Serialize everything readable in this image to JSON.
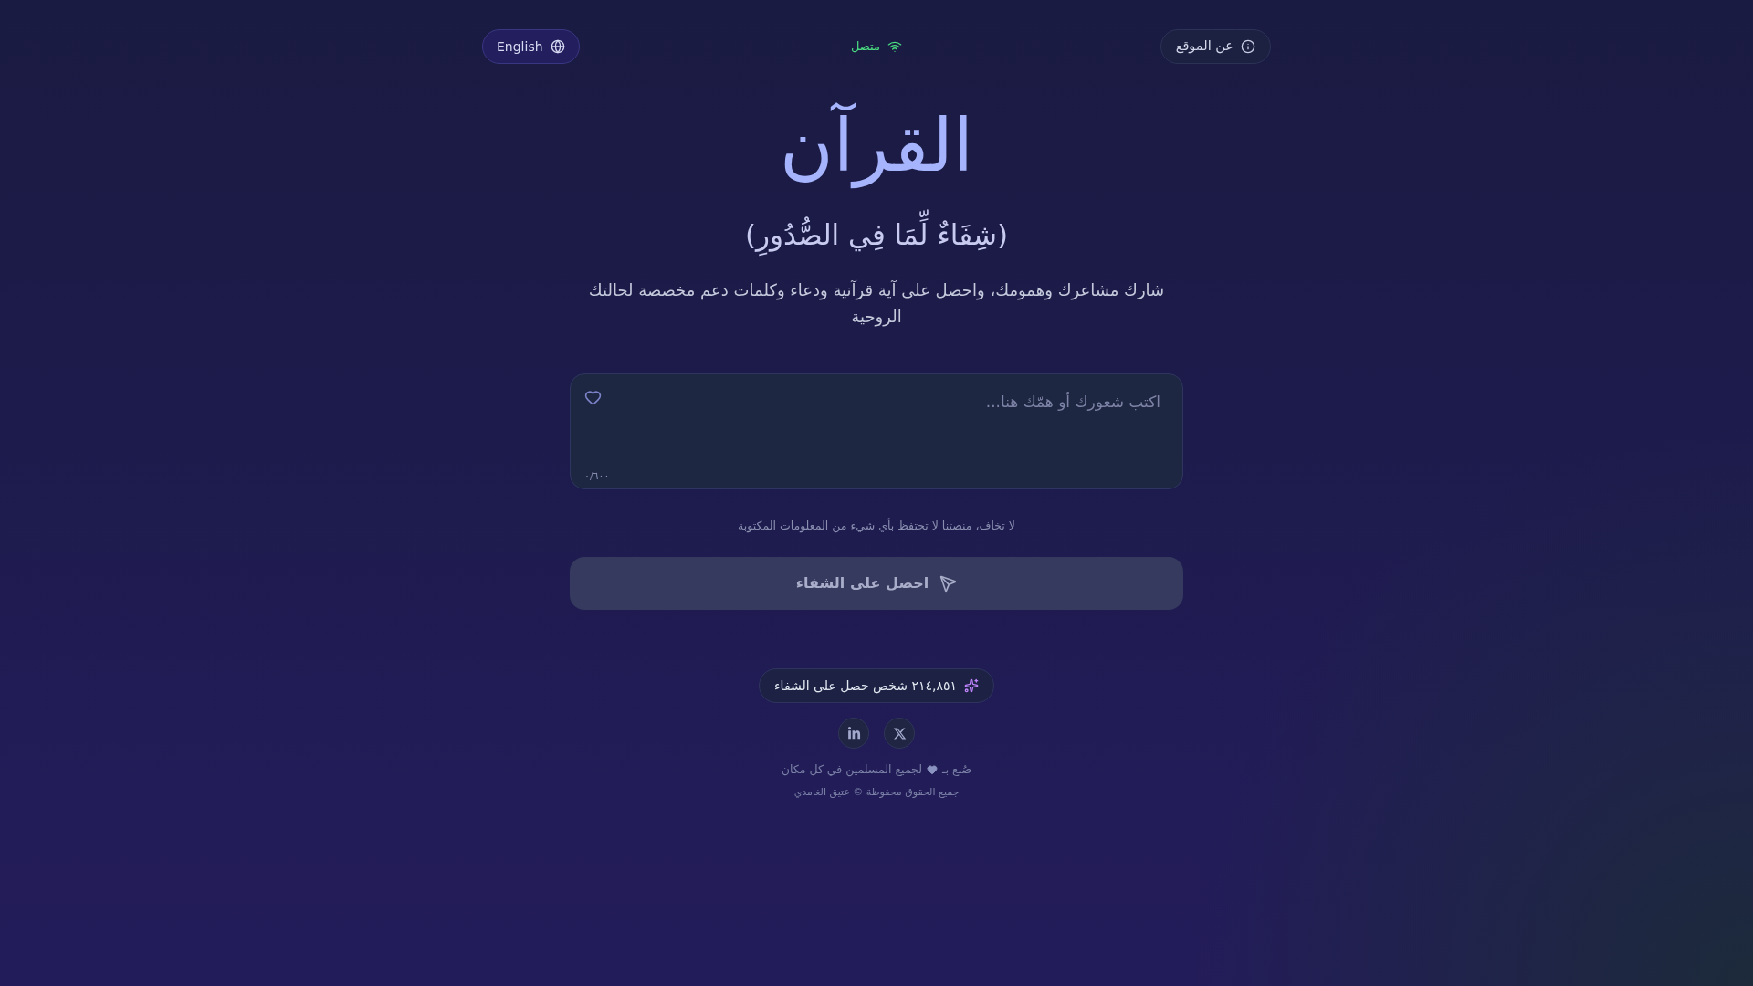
{
  "header": {
    "about_button": {
      "label": "عن الموقع"
    },
    "status": {
      "label": "متصل",
      "connected": true
    },
    "language_button": {
      "label": "English"
    }
  },
  "hero": {
    "title": "القرآن",
    "verse": "(شِفَاءٌ لِّمَا فِي الصُّدُورِ)",
    "description": "شارك مشاعرك وهمومك، واحصل على آية قرآنية ودعاء وكلمات دعم مخصصة لحالتك الروحية"
  },
  "form": {
    "placeholder": "اكتب شعورك أو همّك هنا...",
    "counter": "٠/٦٠٠",
    "privacy_note": "لا تخاف، منصتنا لا تحتفظ بأي شيء من المعلومات المكتوبة",
    "submit_button": {
      "label": "احصل على الشفاء",
      "disabled": true
    }
  },
  "stats": {
    "label": "٢١٤,٨٥١ شخص حصل على الشفاء"
  },
  "social_links": [
    {
      "kind": "x"
    },
    {
      "kind": "linkedin"
    }
  ],
  "footer": {
    "made_with": {
      "before": "صُنع بـ",
      "after": "لجميع المسلمين في كل مكان"
    },
    "copyright": "جميع الحقوق محفوظة © عتيق الغامدي"
  }
}
